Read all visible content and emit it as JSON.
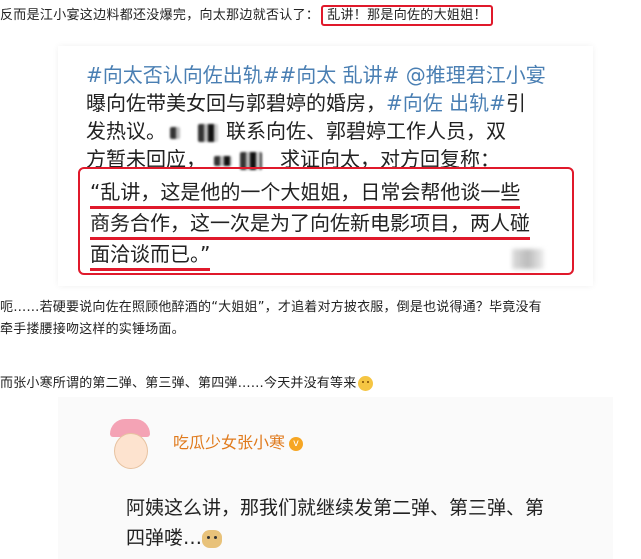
{
  "intro": {
    "text": "反而是江小宴这边料都还没爆完，向太那边就否认了：",
    "boxed_quote": "乱讲！那是向佐的大姐姐！"
  },
  "weibo": {
    "hashtags_line": "#向太否认向佐出轨##向太 乱讲# @推理君江小宴",
    "line2": "曝向佐带美女回与郭碧婷的婚房，",
    "line2_tag": "#向佐 出轨#",
    "line2_end": "引",
    "line3_start": "发热议。",
    "line3_end": "联系向佐、郭碧婷工作人员，双",
    "line4_start": "方暂未回应，",
    "line4_end": "求证向太，对方回复称：",
    "quote": {
      "l1": "“乱讲，这是他的一个大姐姐，日常会帮他谈一些",
      "l2_a": "商务合作，这一次是为了向佐新电影项目，",
      "l2_b": "两人碰",
      "l3": "面洽谈而已。”"
    }
  },
  "body_text": {
    "p1_l1": "呃……若硬要说向佐在照顾他醉酒的“大姐姐”，才追着对方披衣服，倒是也说得通？毕竟没有",
    "p1_l2": "牵手搂腰接吻这样的实锤场面。",
    "p2": "而张小寒所谓的第二弹、第三弹、第四弹……今天并没有等来"
  },
  "post": {
    "username": "吃瓜少女张小寒",
    "badge": "v",
    "l1": "阿姨这么讲，那我们就继续发第二弹、第三弹、第",
    "l2": "四弹喽…"
  },
  "colors": {
    "accent_red": "#e0192b",
    "hashtag_blue": "#4a7fb3",
    "username_orange": "#e07a1c"
  },
  "icons": [
    "smile-emoji-icon",
    "doge-emoji-icon",
    "verified-badge-icon",
    "avatar-cartoon-icon"
  ]
}
